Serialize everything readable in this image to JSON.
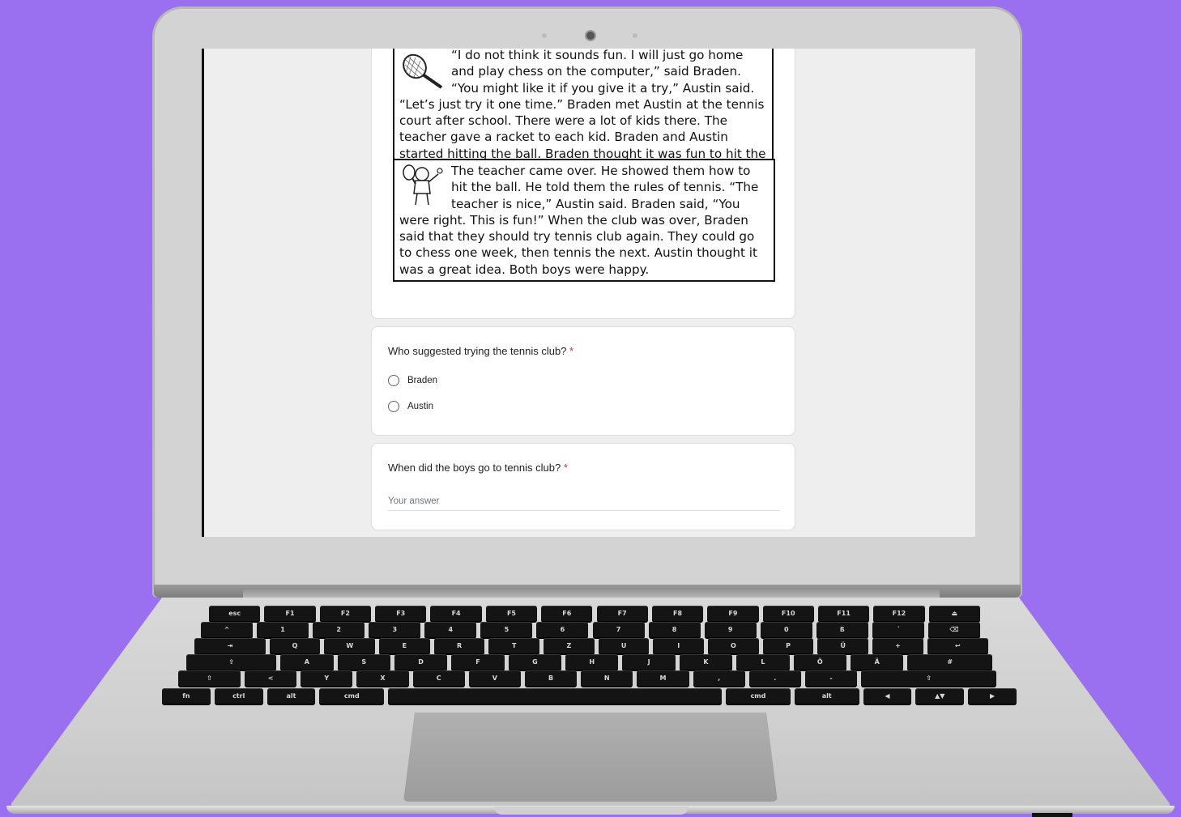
{
  "passage": {
    "paragraph1": "“I do not think it sounds fun. I will just go home and play chess on the computer,” said Braden. “You might like it if you give it a try,” Austin said. “Let’s just try it one time.” Braden met Austin at the tennis court after school. There were a lot of kids there. The teacher gave a racket to each kid. Braden and Austin started hitting the ball. Braden thought it was fun to hit the ball and see how far it would go.",
    "paragraph2": "The teacher came over. He showed them how to hit the ball.  He told them the rules of tennis. “The teacher is nice,” Austin said. Braden said, “You were right. This is fun!” When the club was over, Braden said that they should try tennis club again.  They could go to chess one week, then tennis the next.  Austin thought it was a great idea. Both boys were happy."
  },
  "question1": {
    "title": "Who suggested trying the tennis club?",
    "required_mark": "*",
    "options": [
      "Braden",
      "Austin"
    ]
  },
  "question2": {
    "title": "When did the boys go to tennis club?",
    "required_mark": "*",
    "placeholder": "Your answer"
  },
  "keyboard": {
    "row0": [
      "esc",
      "F1",
      "F2",
      "F3",
      "F4",
      "F5",
      "F6",
      "F7",
      "F8",
      "F9",
      "F10",
      "F11",
      "F12",
      "⏏"
    ],
    "row1": [
      "^",
      "1",
      "2",
      "3",
      "4",
      "5",
      "6",
      "7",
      "8",
      "9",
      "0",
      "ß",
      "´",
      "⌫"
    ],
    "row2": [
      "⇥",
      "Q",
      "W",
      "E",
      "R",
      "T",
      "Z",
      "U",
      "I",
      "O",
      "P",
      "Ü",
      "+",
      "↩"
    ],
    "row3": [
      "⇪",
      "A",
      "S",
      "D",
      "F",
      "G",
      "H",
      "J",
      "K",
      "L",
      "Ö",
      "Ä",
      "#"
    ],
    "row4": [
      "⇧",
      "<",
      "Y",
      "X",
      "C",
      "V",
      "B",
      "N",
      "M",
      ",",
      ".",
      "-",
      "⇧"
    ],
    "row5": [
      "fn",
      "ctrl",
      "alt",
      "cmd",
      "",
      "cmd",
      "alt",
      "◀",
      "▲▼",
      "▶"
    ]
  }
}
